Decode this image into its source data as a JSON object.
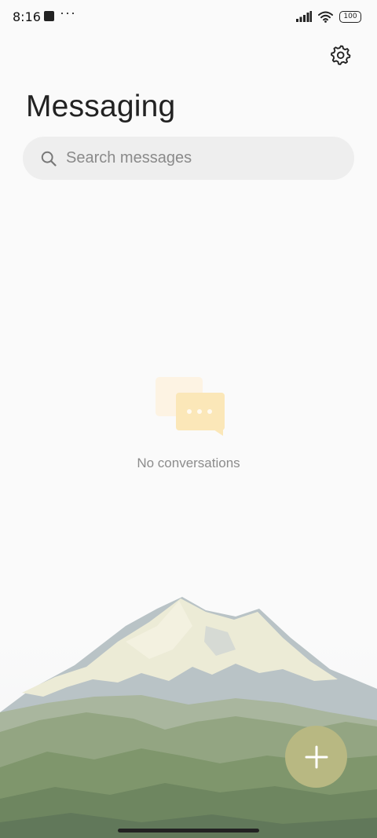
{
  "status_bar": {
    "time": "8:16",
    "more_indicator": "···",
    "battery_level": "100",
    "icons": [
      "notification-square-icon",
      "signal-icon",
      "wifi-icon",
      "battery-icon"
    ]
  },
  "header": {
    "title": "Messaging",
    "settings_icon": "gear-icon"
  },
  "search": {
    "placeholder": "Search messages",
    "value": "",
    "icon": "search-icon"
  },
  "empty_state": {
    "icon": "chat-bubbles-icon",
    "message": "No conversations"
  },
  "fab": {
    "icon": "plus-icon"
  },
  "colors": {
    "background": "#fafafa",
    "search_bg": "#eeeeee",
    "fab": "#b8b882",
    "muted_text": "#8c8c8c",
    "empty_icon_front": "#fbe7b8",
    "empty_icon_back": "#fdf3e3"
  }
}
